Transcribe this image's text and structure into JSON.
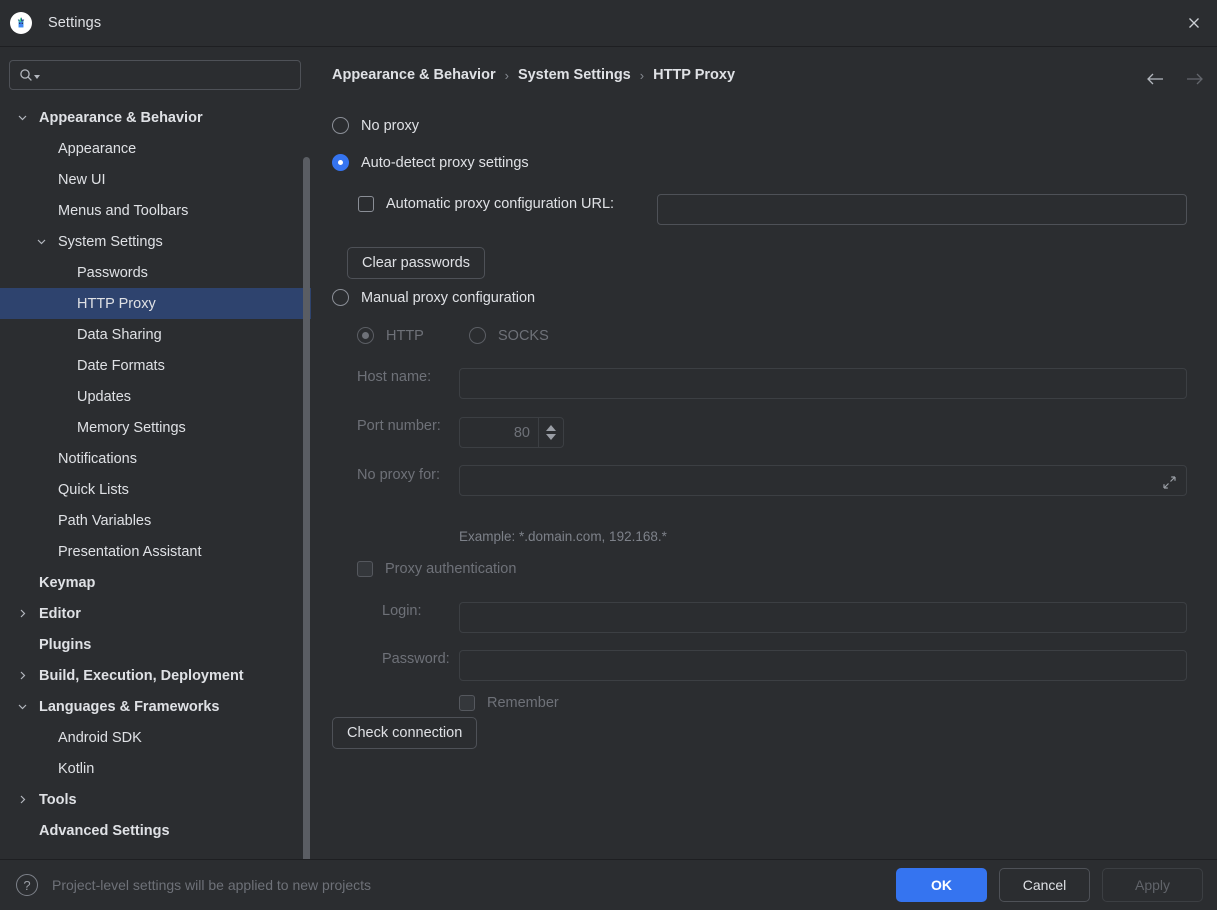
{
  "window": {
    "title": "Settings",
    "app_icon": "android-studio-logo",
    "close_icon": "close-icon"
  },
  "sidebar": {
    "search": {
      "icon": "search-icon",
      "value": "",
      "placeholder": ""
    },
    "items": [
      {
        "label": "Appearance & Behavior",
        "indent": 0,
        "bold": true,
        "chevron": "down",
        "selected": false
      },
      {
        "label": "Appearance",
        "indent": 1,
        "bold": false,
        "chevron": "",
        "selected": false
      },
      {
        "label": "New UI",
        "indent": 1,
        "bold": false,
        "chevron": "",
        "selected": false
      },
      {
        "label": "Menus and Toolbars",
        "indent": 1,
        "bold": false,
        "chevron": "",
        "selected": false
      },
      {
        "label": "System Settings",
        "indent": 1,
        "bold": false,
        "chevron": "down",
        "selected": false
      },
      {
        "label": "Passwords",
        "indent": 2,
        "bold": false,
        "chevron": "",
        "selected": false
      },
      {
        "label": "HTTP Proxy",
        "indent": 2,
        "bold": false,
        "chevron": "",
        "selected": true
      },
      {
        "label": "Data Sharing",
        "indent": 2,
        "bold": false,
        "chevron": "",
        "selected": false
      },
      {
        "label": "Date Formats",
        "indent": 2,
        "bold": false,
        "chevron": "",
        "selected": false
      },
      {
        "label": "Updates",
        "indent": 2,
        "bold": false,
        "chevron": "",
        "selected": false
      },
      {
        "label": "Memory Settings",
        "indent": 2,
        "bold": false,
        "chevron": "",
        "selected": false
      },
      {
        "label": "Notifications",
        "indent": 1,
        "bold": false,
        "chevron": "",
        "selected": false
      },
      {
        "label": "Quick Lists",
        "indent": 1,
        "bold": false,
        "chevron": "",
        "selected": false
      },
      {
        "label": "Path Variables",
        "indent": 1,
        "bold": false,
        "chevron": "",
        "selected": false
      },
      {
        "label": "Presentation Assistant",
        "indent": 1,
        "bold": false,
        "chevron": "",
        "selected": false
      },
      {
        "label": "Keymap",
        "indent": 0,
        "bold": true,
        "chevron": "",
        "selected": false
      },
      {
        "label": "Editor",
        "indent": 0,
        "bold": true,
        "chevron": "right",
        "selected": false
      },
      {
        "label": "Plugins",
        "indent": 0,
        "bold": true,
        "chevron": "",
        "selected": false
      },
      {
        "label": "Build, Execution, Deployment",
        "indent": 0,
        "bold": true,
        "chevron": "right",
        "selected": false
      },
      {
        "label": "Languages & Frameworks",
        "indent": 0,
        "bold": true,
        "chevron": "down",
        "selected": false
      },
      {
        "label": "Android SDK",
        "indent": 1,
        "bold": false,
        "chevron": "",
        "selected": false
      },
      {
        "label": "Kotlin",
        "indent": 1,
        "bold": false,
        "chevron": "",
        "selected": false
      },
      {
        "label": "Tools",
        "indent": 0,
        "bold": true,
        "chevron": "right",
        "selected": false
      },
      {
        "label": "Advanced Settings",
        "indent": 0,
        "bold": true,
        "chevron": "",
        "selected": false
      }
    ]
  },
  "breadcrumb": {
    "items": [
      "Appearance & Behavior",
      "System Settings",
      "HTTP Proxy"
    ],
    "separator": "›",
    "back_icon": "arrow-left-icon",
    "forward_icon": "arrow-right-icon"
  },
  "proxy": {
    "no_proxy_label": "No proxy",
    "auto_detect_label": "Auto-detect proxy settings",
    "auto_config_url_label": "Automatic proxy configuration URL:",
    "auto_config_url_value": "",
    "clear_passwords_label": "Clear passwords",
    "manual_label": "Manual proxy configuration",
    "http_label": "HTTP",
    "socks_label": "SOCKS",
    "host_name_label": "Host name:",
    "host_name_value": "",
    "port_number_label": "Port number:",
    "port_number_value": "80",
    "no_proxy_for_label": "No proxy for:",
    "no_proxy_for_value": "",
    "expand_icon": "expand-icon",
    "example_text": "Example: *.domain.com, 192.168.*",
    "proxy_auth_label": "Proxy authentication",
    "login_label": "Login:",
    "login_value": "",
    "password_label": "Password:",
    "password_value": "",
    "remember_label": "Remember",
    "check_connection_label": "Check connection",
    "selected_mode": "auto-detect",
    "selected_protocol": "HTTP"
  },
  "footer": {
    "help_icon": "help-icon",
    "note": "Project-level settings will be applied to new projects",
    "ok_label": "OK",
    "cancel_label": "Cancel",
    "apply_label": "Apply"
  },
  "colors": {
    "background": "#2b2d30",
    "accent": "#3574f0",
    "selection": "#2e436e",
    "text": "#dfe1e5",
    "text_disabled": "#6e7178"
  }
}
